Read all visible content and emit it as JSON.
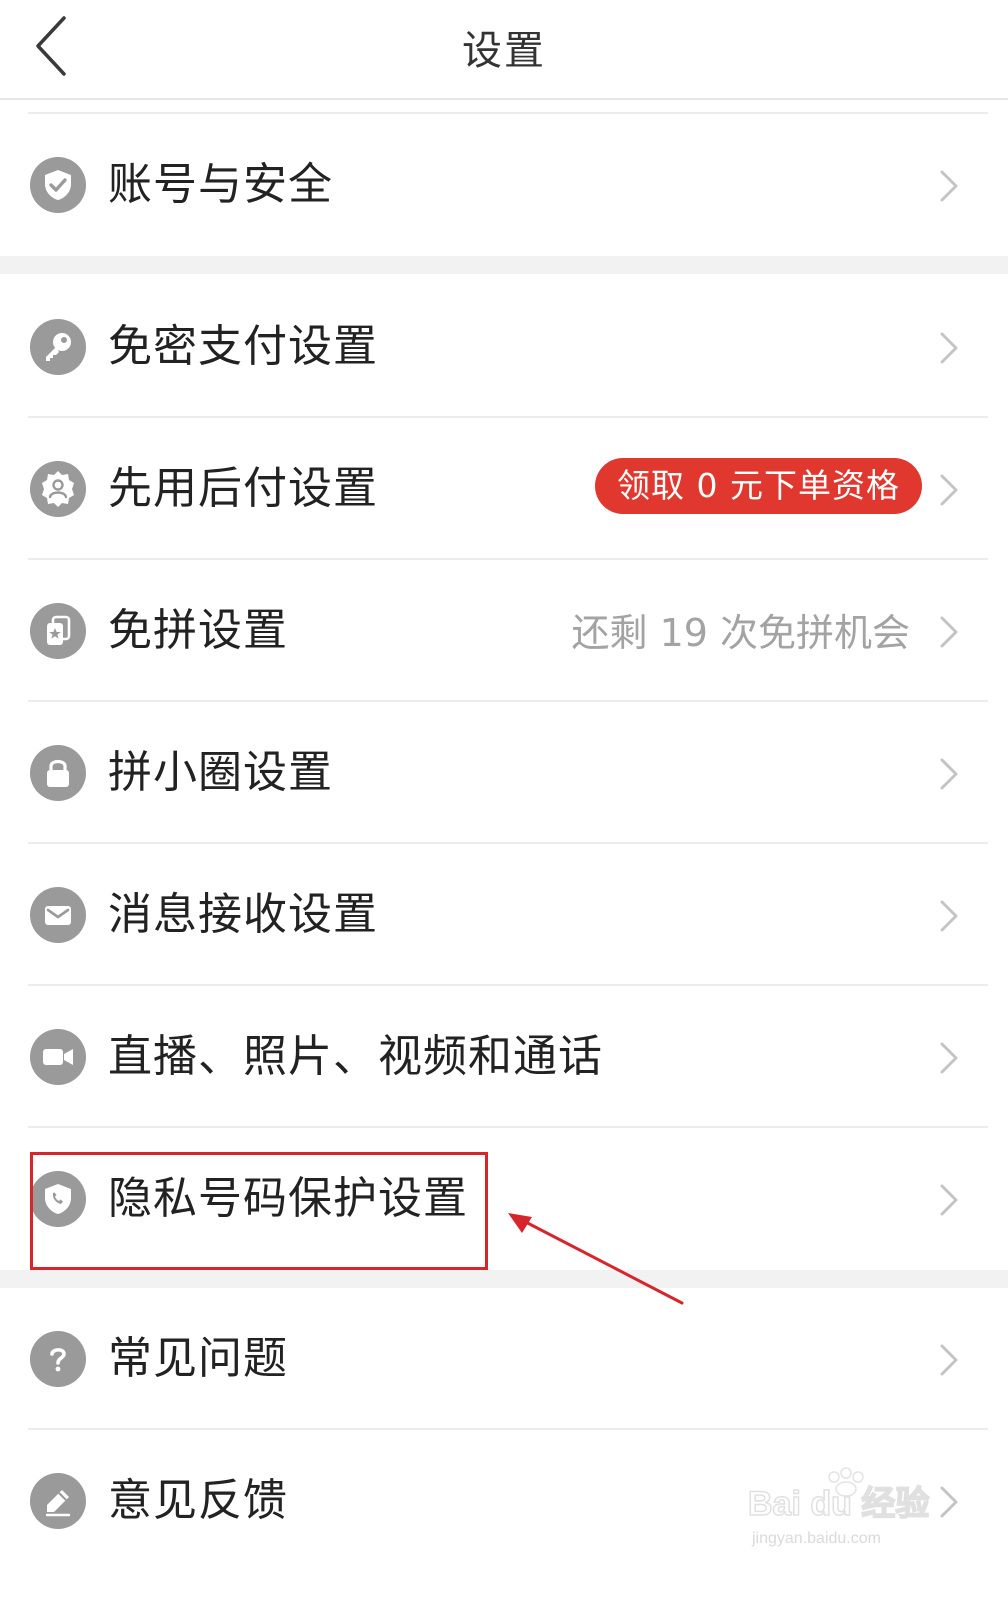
{
  "header": {
    "title": "设置",
    "back_icon": "chevron-left-icon"
  },
  "settings": {
    "account_security": {
      "label": "账号与安全",
      "icon": "shield-check-icon"
    },
    "password_free_pay": {
      "label": "免密支付设置",
      "icon": "key-icon"
    },
    "pay_later": {
      "label": "先用后付设置",
      "icon": "badge-user-icon",
      "promo": "领取 0 元下单资格"
    },
    "free_group": {
      "label": "免拼设置",
      "icon": "card-star-icon",
      "value": "还剩 19 次免拼机会"
    },
    "small_circle": {
      "label": "拼小圈设置",
      "icon": "lock-icon"
    },
    "message_receive": {
      "label": "消息接收设置",
      "icon": "mail-icon"
    },
    "live_photo_video": {
      "label": "直播、照片、视频和通话",
      "icon": "video-camera-icon"
    },
    "privacy_number": {
      "label": "隐私号码保护设置",
      "icon": "shield-phone-icon"
    },
    "faq": {
      "label": "常见问题",
      "icon": "question-icon"
    },
    "feedback": {
      "label": "意见反馈",
      "icon": "pencil-icon"
    }
  },
  "annotation": {
    "highlight_color": "#d6262b",
    "arrow_color": "#d6262b"
  },
  "watermark": {
    "brand": "Bai du 经验",
    "url": "jingyan.baidu.com"
  },
  "colors": {
    "promo_bg": "#e0372f",
    "icon_gray": "#9a9a9a",
    "secondary_text": "#a3a3a3",
    "section_gap": "#f2f2f2"
  }
}
